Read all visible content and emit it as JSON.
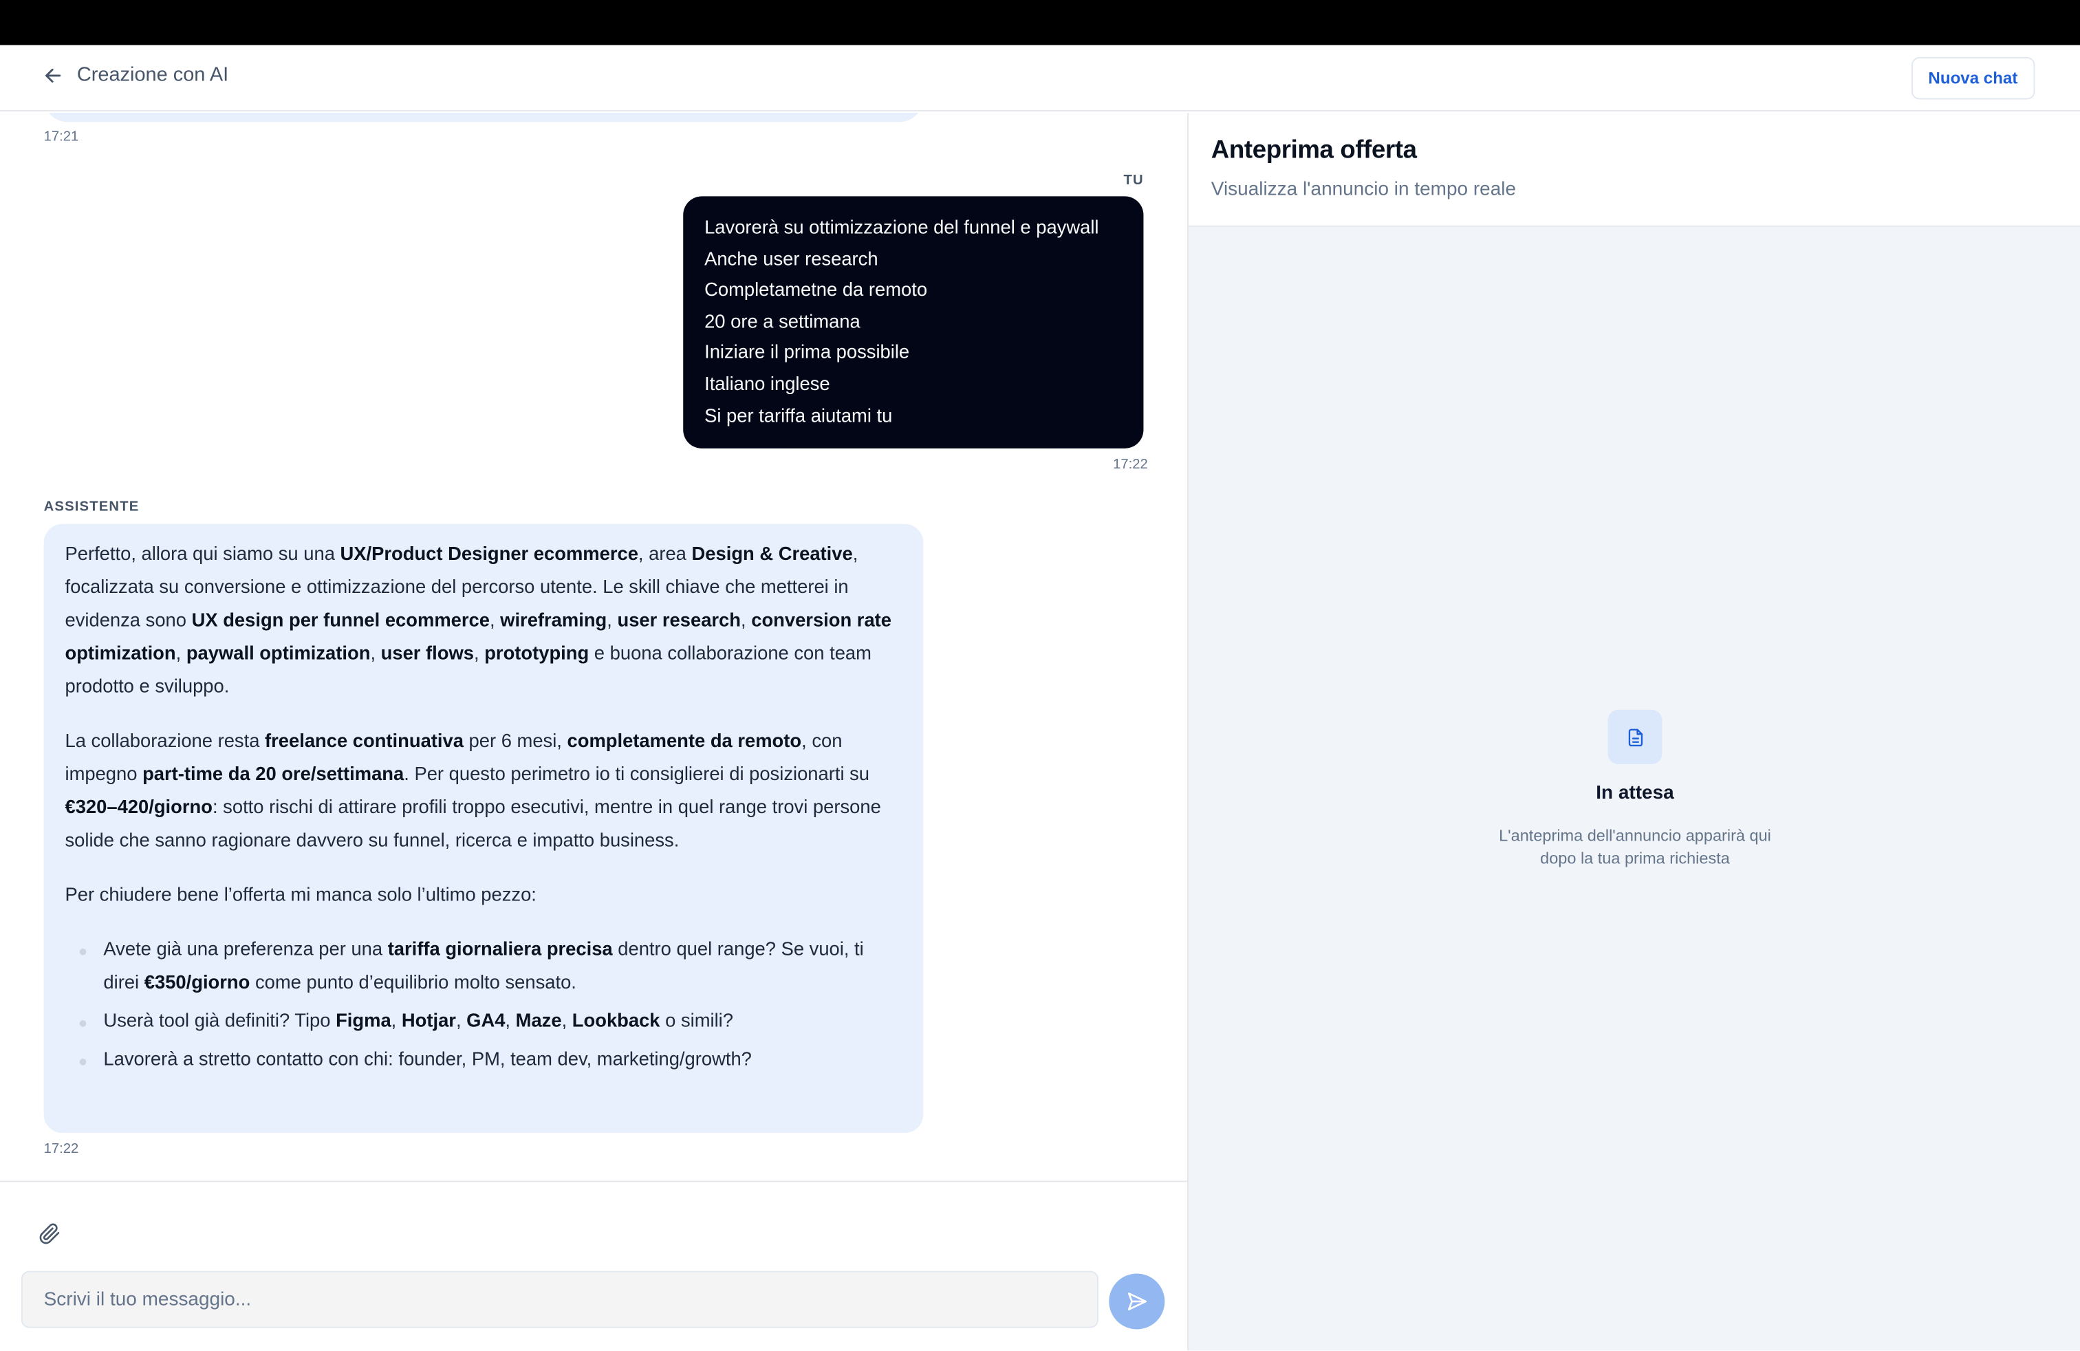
{
  "header": {
    "back_label": "Creazione con AI",
    "new_chat_label": "Nuova chat"
  },
  "chat": {
    "prev_time": "17:21",
    "user_role": "TU",
    "user_lines": [
      "Lavorerà su ottimizzazione del funnel e paywall",
      "Anche user research",
      "Completametne da remoto",
      "20 ore a settimana",
      "Iniziare il prima possibile",
      "Italiano inglese",
      "Si per tariffa aiutami tu"
    ],
    "user_time": "17:22",
    "assistant_role": "ASSISTENTE",
    "assistant_time": "17:22",
    "assistant_paragraphs": [
      [
        {
          "t": "Perfetto, allora qui siamo su una "
        },
        {
          "t": "UX/Product Designer ecommerce",
          "b": true
        },
        {
          "t": ", area "
        },
        {
          "t": "Design & Creative",
          "b": true
        },
        {
          "t": ", focalizzata su conversione e ottimizzazione del percorso utente. Le skill chiave che metterei in evidenza sono "
        },
        {
          "t": "UX design per funnel ecommerce",
          "b": true
        },
        {
          "t": ", "
        },
        {
          "t": "wireframing",
          "b": true
        },
        {
          "t": ", "
        },
        {
          "t": "user research",
          "b": true
        },
        {
          "t": ", "
        },
        {
          "t": "conversion rate optimization",
          "b": true
        },
        {
          "t": ", "
        },
        {
          "t": "paywall optimization",
          "b": true
        },
        {
          "t": ", "
        },
        {
          "t": "user flows",
          "b": true
        },
        {
          "t": ", "
        },
        {
          "t": "prototyping",
          "b": true
        },
        {
          "t": " e buona collaborazione con team prodotto e sviluppo."
        }
      ],
      [
        {
          "t": "La collaborazione resta "
        },
        {
          "t": "freelance continuativa",
          "b": true
        },
        {
          "t": " per 6 mesi, "
        },
        {
          "t": "completamente da remoto",
          "b": true
        },
        {
          "t": ", con impegno "
        },
        {
          "t": "part-time da 20 ore/settimana",
          "b": true
        },
        {
          "t": ". Per questo perimetro io ti consiglierei di posizionarti su "
        },
        {
          "t": "€320–420/giorno",
          "b": true
        },
        {
          "t": ": sotto rischi di attirare profili troppo esecutivi, mentre in quel range trovi persone solide che sanno ragionare davvero su funnel, ricerca e impatto business."
        }
      ],
      [
        {
          "t": "Per chiudere bene l’offerta mi manca solo l’ultimo pezzo:"
        }
      ]
    ],
    "assistant_bullets": [
      [
        {
          "t": "Avete già una preferenza per una "
        },
        {
          "t": "tariffa giornaliera precisa",
          "b": true
        },
        {
          "t": " dentro quel range? Se vuoi, ti direi "
        },
        {
          "t": "€350/giorno",
          "b": true
        },
        {
          "t": " come punto d’equilibrio molto sensato."
        }
      ],
      [
        {
          "t": "Userà tool già definiti? Tipo "
        },
        {
          "t": "Figma",
          "b": true
        },
        {
          "t": ", "
        },
        {
          "t": "Hotjar",
          "b": true
        },
        {
          "t": ", "
        },
        {
          "t": "GA4",
          "b": true
        },
        {
          "t": ", "
        },
        {
          "t": "Maze",
          "b": true
        },
        {
          "t": ", "
        },
        {
          "t": "Lookback",
          "b": true
        },
        {
          "t": " o simili?"
        }
      ],
      [
        {
          "t": "Lavorerà a stretto contatto con chi: founder, PM, team dev, marketing/growth?"
        }
      ]
    ]
  },
  "composer": {
    "placeholder": "Scrivi il tuo messaggio...",
    "attach_icon": "paperclip-icon",
    "send_icon": "send-icon"
  },
  "preview": {
    "title": "Anteprima offerta",
    "subtitle": "Visualizza l'annuncio in tempo reale",
    "status_icon": "document-icon",
    "status_title": "In attesa",
    "status_desc": "L'anteprima dell'annuncio apparirà qui\ndopo la tua prima richiesta"
  },
  "colors": {
    "accent": "#1d5fd6",
    "user_bubble": "#020617",
    "assistant_bubble": "#e8f0fd",
    "send_button": "#93b7f0",
    "preview_bg": "#f1f5f9"
  }
}
